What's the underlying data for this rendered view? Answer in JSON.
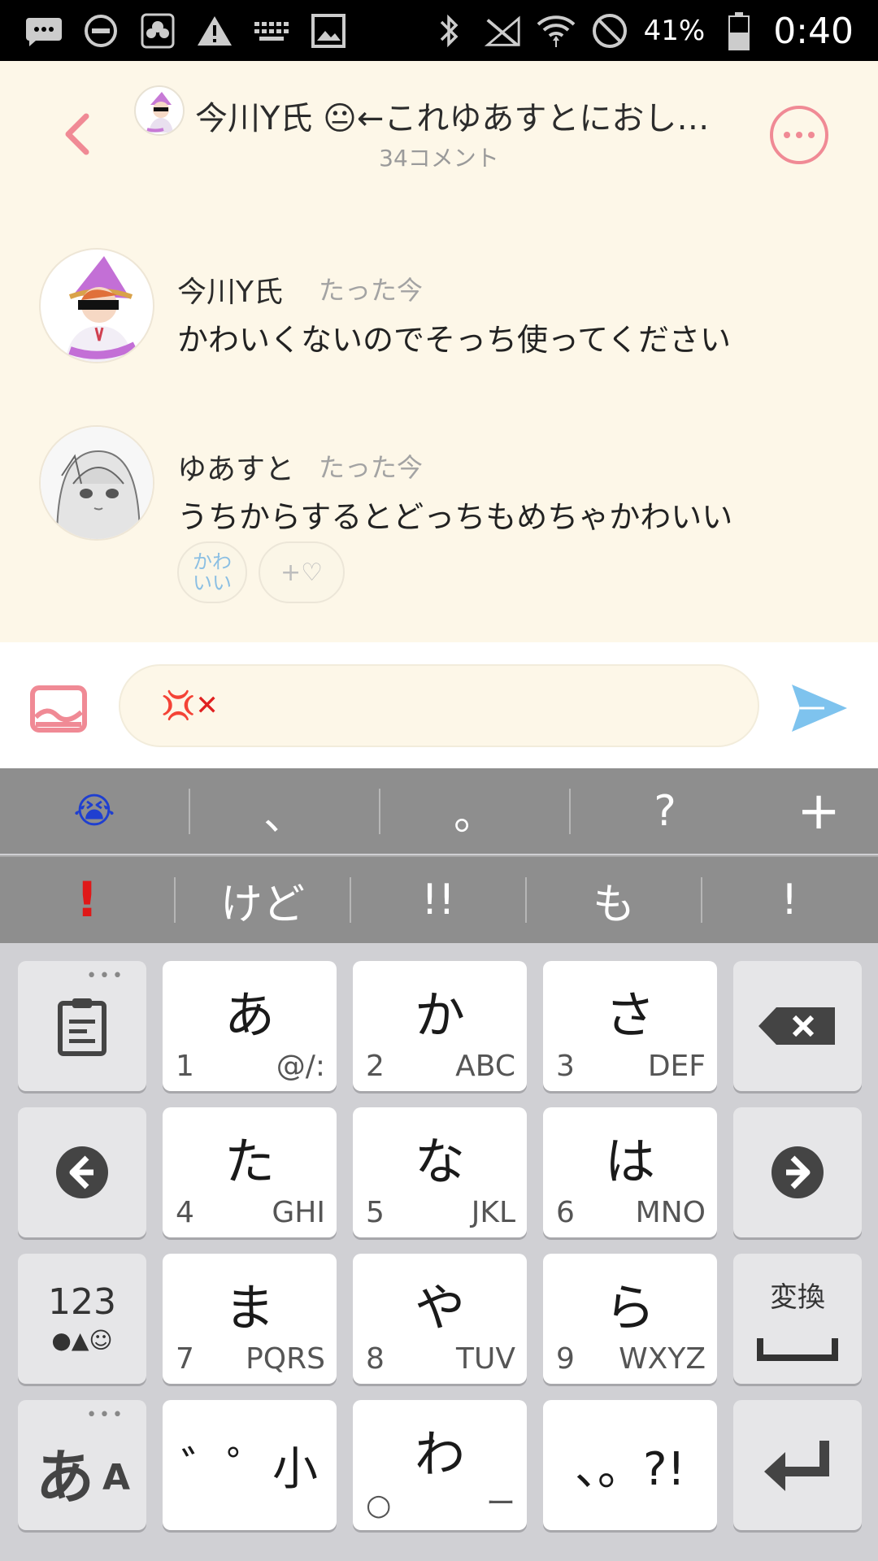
{
  "status_bar": {
    "battery": "41%",
    "time": "0:40",
    "icons_left": [
      "message-icon",
      "do-not-disturb-icon",
      "app-icon",
      "warning-icon",
      "keyboard-icon",
      "image-icon"
    ],
    "icons_right": [
      "bluetooth-icon",
      "no-signal-icon",
      "wifi-icon",
      "blocked-icon",
      "battery-icon"
    ]
  },
  "header": {
    "title": "今川Y氏 😐←これゆあすとにおしが…",
    "subtitle": "34コメント",
    "accent_color": "#f08a95"
  },
  "messages": [
    {
      "name": "今川Y氏",
      "time": "たった今",
      "text": "かわいくないのでそっち使ってください"
    },
    {
      "name": "ゆあすと",
      "time": "たった今",
      "text": "うちからするとどっちもめちゃかわいい",
      "reactions": {
        "kawaii_line1": "かわ",
        "kawaii_line2": "いい",
        "add_label": "+♡"
      }
    }
  ],
  "input": {
    "value": "💢✕"
  },
  "suggestions_row1": [
    "😭",
    "、",
    "。",
    "?",
    "+"
  ],
  "suggestions_row2": [
    "!",
    "けど",
    "!!",
    "も",
    "!"
  ],
  "keyboard": {
    "keys": [
      {
        "main": "あ",
        "num": "1",
        "alt": "@/:"
      },
      {
        "main": "か",
        "num": "2",
        "alt": "ABC"
      },
      {
        "main": "さ",
        "num": "3",
        "alt": "DEF"
      },
      {
        "main": "た",
        "num": "4",
        "alt": "GHI"
      },
      {
        "main": "な",
        "num": "5",
        "alt": "JKL"
      },
      {
        "main": "は",
        "num": "6",
        "alt": "MNO"
      },
      {
        "main": "ま",
        "num": "7",
        "alt": "PQRS"
      },
      {
        "main": "や",
        "num": "8",
        "alt": "TUV"
      },
      {
        "main": "ら",
        "num": "9",
        "alt": "WXYZ"
      },
      {
        "main": "゛゜小",
        "num": "",
        "alt": ""
      },
      {
        "main": "わ",
        "num": "○",
        "alt": "ー"
      },
      {
        "main": "、。?!",
        "num": "",
        "alt": ""
      }
    ],
    "num_mode_label": "123",
    "num_mode_sub": "●▲☺",
    "convert_label": "変換",
    "kana_label": "あ",
    "kana_label_small": "A",
    "dots": "•••"
  }
}
